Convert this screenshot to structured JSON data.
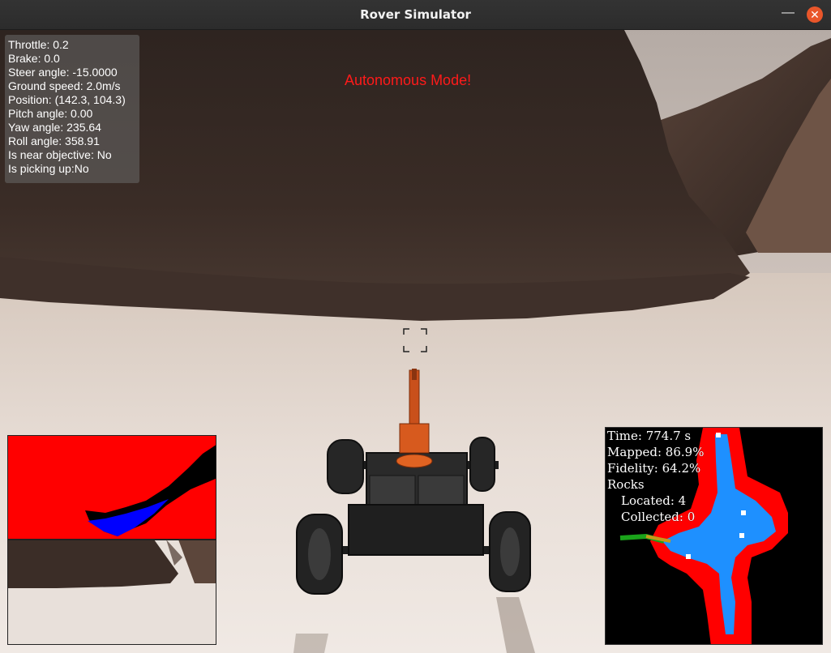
{
  "window": {
    "title": "Rover Simulator"
  },
  "telemetry": {
    "throttle": "Throttle: 0.2",
    "brake": "Brake: 0.0",
    "steer_angle": "Steer angle: -15.0000",
    "ground_speed": "Ground speed: 2.0m/s",
    "position": "Position: (142.3, 104.3)",
    "pitch_angle": "Pitch angle: 0.00",
    "yaw_angle": "Yaw angle: 235.64",
    "roll_angle": "Roll angle: 358.91",
    "near_objective": "Is near objective: No",
    "picking_up": "Is picking up:No"
  },
  "mode_banner": "Autonomous Mode!",
  "worldmap_stats": {
    "time": "Time: 774.7 s",
    "mapped": "Mapped: 86.9%",
    "fidelity": "Fidelity: 64.2%",
    "rocks_header": "Rocks",
    "located": "Located: 4",
    "collected": "Collected: 0"
  },
  "colors": {
    "mode_banner": "#ff1a1a",
    "navigable": "#1e90ff",
    "obstacle": "#ff0000",
    "close_button": "#e9562a"
  },
  "icons": [
    "minimize-icon",
    "close-icon",
    "crosshair-icon"
  ]
}
